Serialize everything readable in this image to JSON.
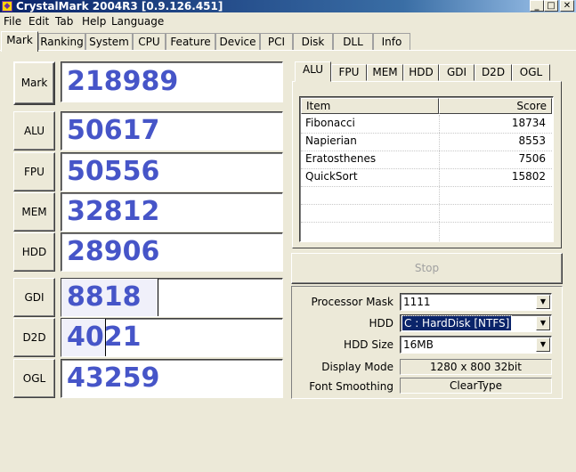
{
  "window": {
    "title": "CrystalMark 2004R3 [0.9.126.451]",
    "app_icon": "crystal-icon",
    "controls": {
      "minimize": "_",
      "maximize": "□",
      "close": "✕"
    }
  },
  "menu": [
    "File",
    "Edit",
    "Tab",
    "Help",
    "Language"
  ],
  "main_tabs": [
    "Mark",
    "Ranking",
    "System",
    "CPU",
    "Feature",
    "Device",
    "PCI",
    "Disk",
    "DLL",
    "Info"
  ],
  "active_main_tab": "Mark",
  "scores": {
    "mark": {
      "label": "Mark",
      "value": "218989"
    },
    "alu": {
      "label": "ALU",
      "value": "50617"
    },
    "fpu": {
      "label": "FPU",
      "value": "50556"
    },
    "mem": {
      "label": "MEM",
      "value": "32812"
    },
    "hdd": {
      "label": "HDD",
      "value": "28906"
    },
    "gdi": {
      "label": "GDI",
      "value": "8818",
      "bar_fraction": 0.44
    },
    "d2d": {
      "label": "D2D",
      "value": "4021",
      "bar_fraction": 0.2
    },
    "ogl": {
      "label": "OGL",
      "value": "43259"
    }
  },
  "sub_tabs": [
    "ALU",
    "FPU",
    "MEM",
    "HDD",
    "GDI",
    "D2D",
    "OGL"
  ],
  "active_sub_tab": "ALU",
  "result_table": {
    "headers": {
      "item": "Item",
      "score": "Score"
    },
    "rows": [
      {
        "item": "Fibonacci",
        "score": "18734"
      },
      {
        "item": "Napierian",
        "score": "8553"
      },
      {
        "item": "Eratosthenes",
        "score": "7506"
      },
      {
        "item": "QuickSort",
        "score": "15802"
      }
    ]
  },
  "stop_button": "Stop",
  "settings": {
    "processor_mask": {
      "label": "Processor Mask",
      "value": "1111"
    },
    "hdd": {
      "label": "HDD",
      "value": "C : HardDisk [NTFS]"
    },
    "hdd_size": {
      "label": "HDD Size",
      "value": "16MB"
    },
    "display_mode": {
      "label": "Display Mode",
      "value": "1280 x 800 32bit"
    },
    "font_smoothing": {
      "label": "Font Smoothing",
      "value": "ClearType"
    }
  },
  "colors": {
    "score_text": "#4655c8",
    "titlebar": "#0a246a",
    "face": "#ece9d8"
  }
}
